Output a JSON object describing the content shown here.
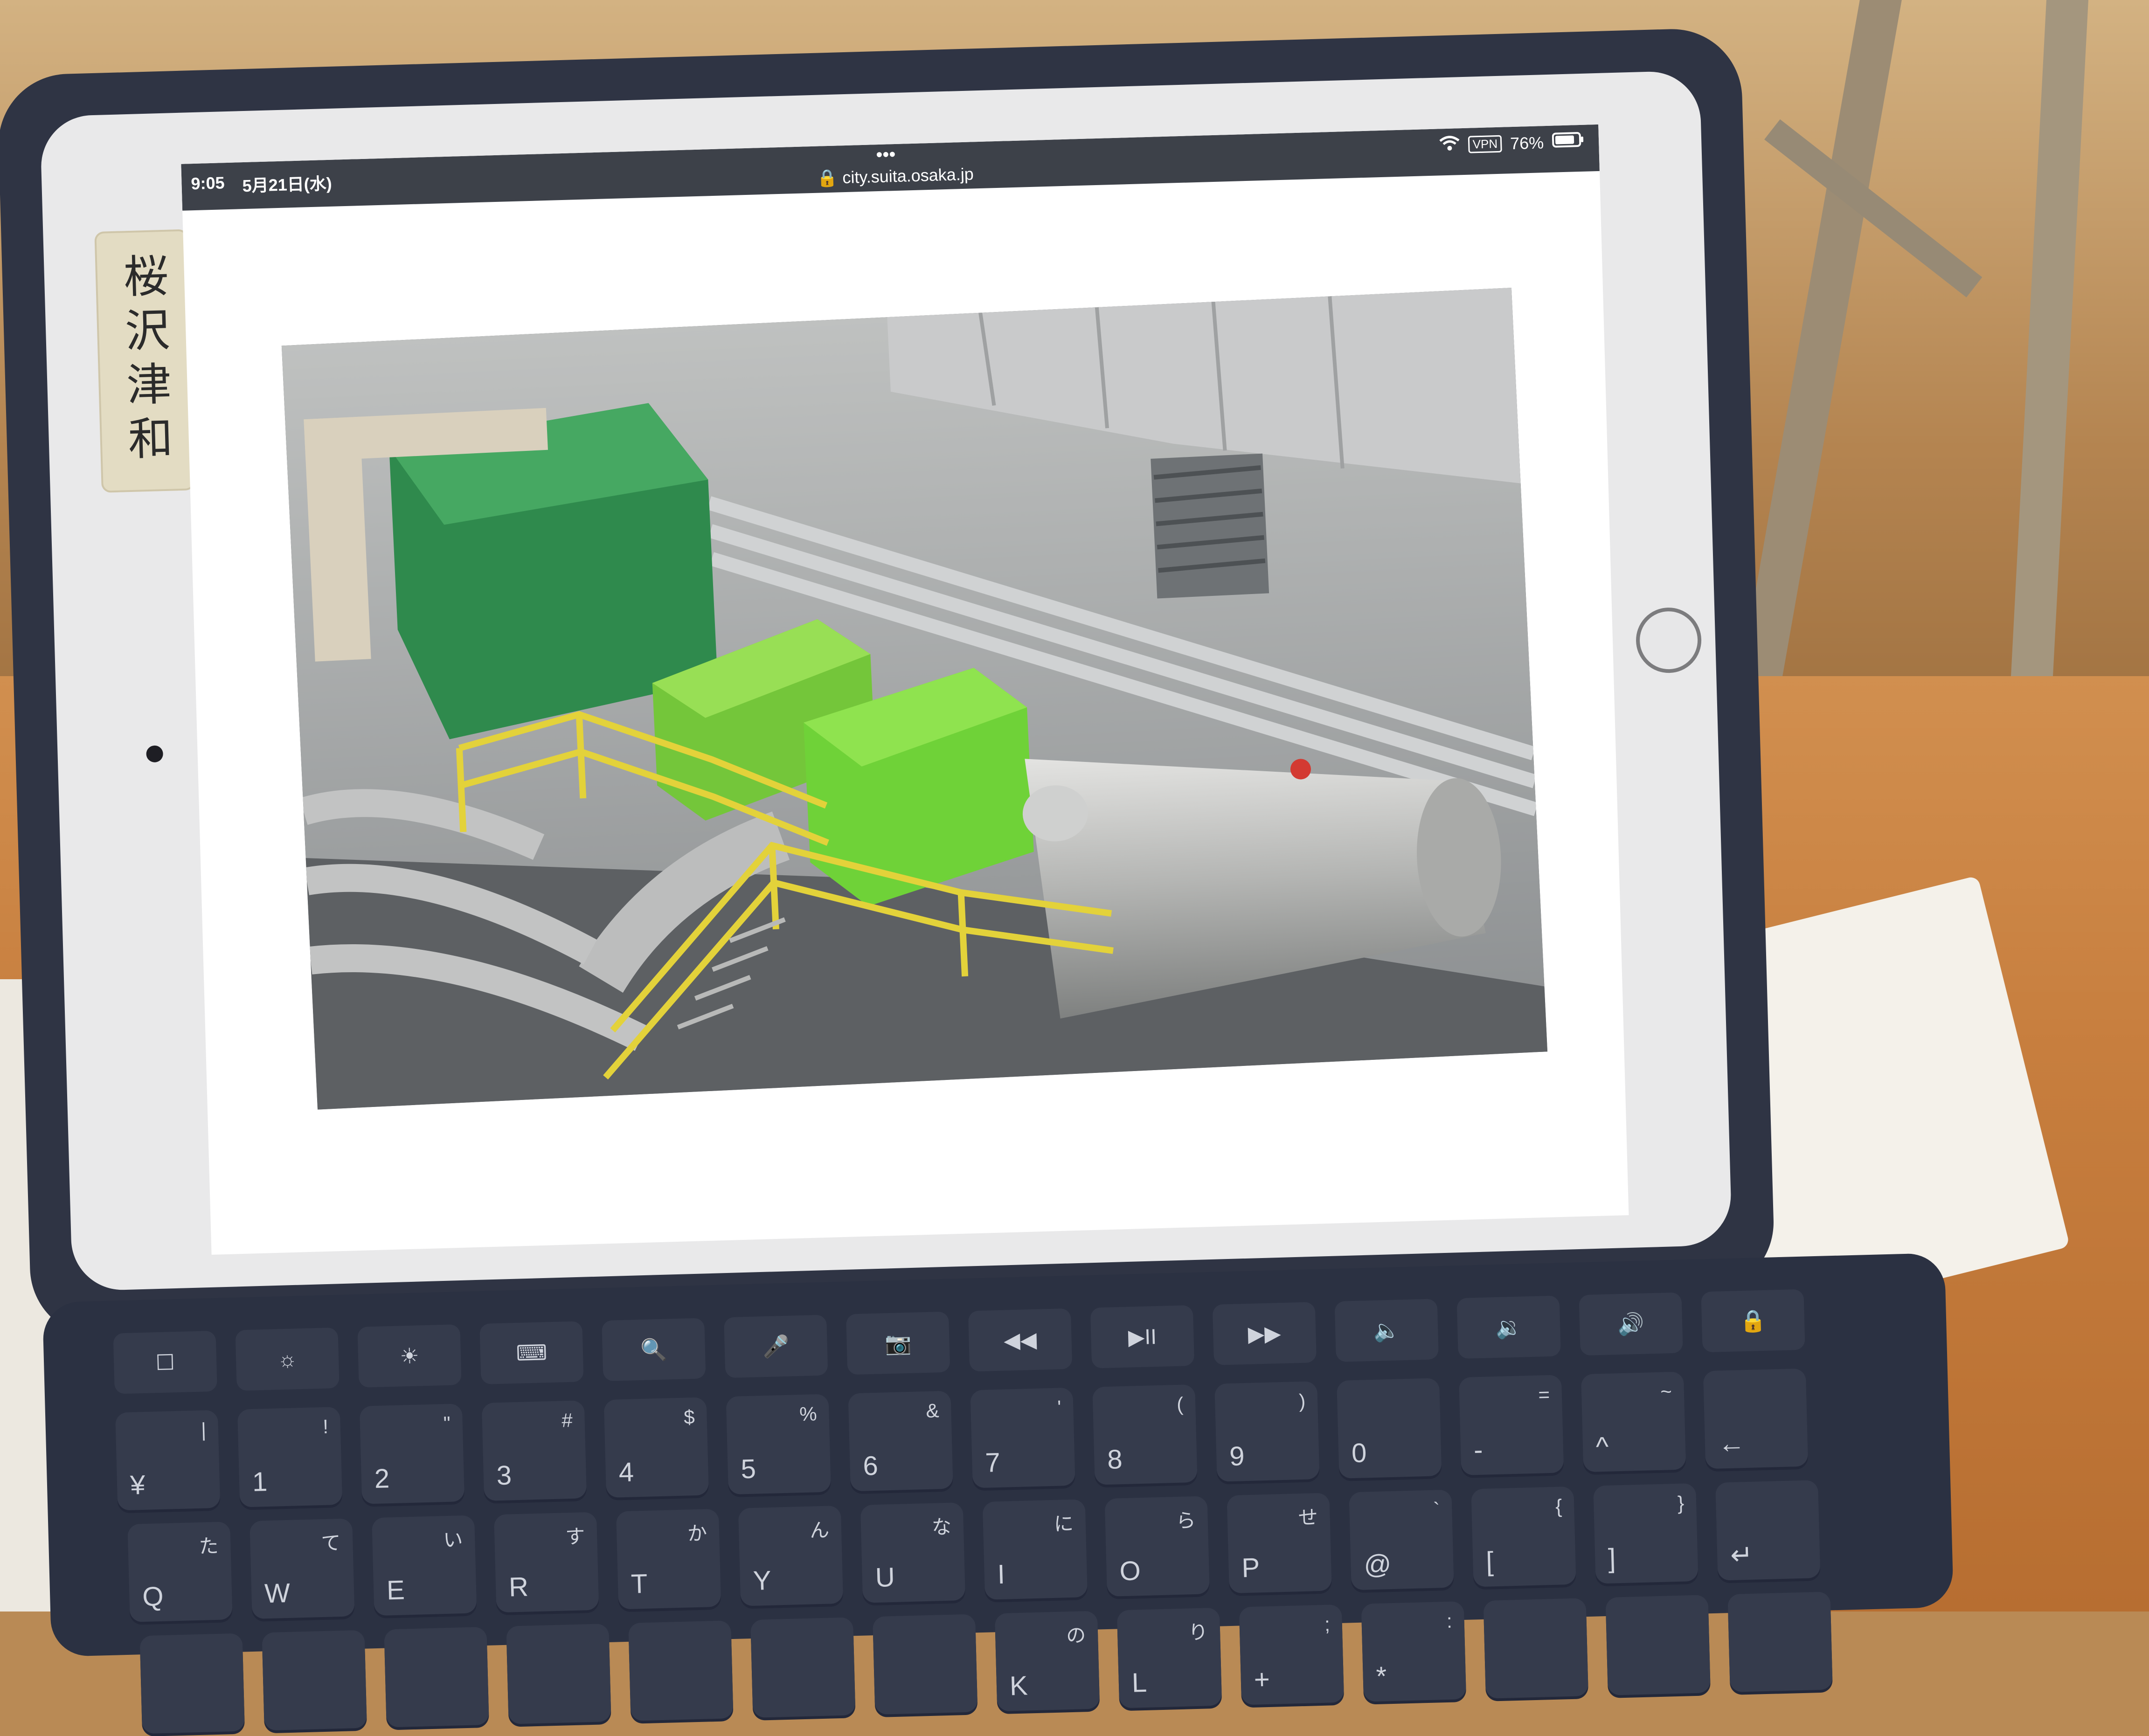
{
  "scene": {
    "sticker_label": "桜沢津和",
    "colors": {
      "device_frame": "#2f3444",
      "bezel": "#e9e9ea",
      "desk": "#c77e3e",
      "keyboard": "#2b3142"
    }
  },
  "status_bar": {
    "time": "9:05",
    "date": "5月21日(水)",
    "url": "city.suita.osaka.jp",
    "dots": "•••",
    "vpn": "VPN",
    "battery": "76%",
    "icons": [
      "wifi-icon",
      "lock-icon",
      "battery-icon"
    ]
  },
  "keyboard": {
    "function_row": [
      "☐",
      "☼",
      "☀",
      "⌨",
      "🔍",
      "🎤",
      "📷",
      "◀◀",
      "▶II",
      "▶▶",
      "🔈",
      "🔉",
      "🔊",
      "🔒"
    ],
    "number_row": [
      {
        "p": "¥",
        "s": "|"
      },
      {
        "p": "1",
        "s": "!"
      },
      {
        "p": "2",
        "s": "\""
      },
      {
        "p": "3",
        "s": "#"
      },
      {
        "p": "4",
        "s": "$"
      },
      {
        "p": "5",
        "s": "%"
      },
      {
        "p": "6",
        "s": "&"
      },
      {
        "p": "7",
        "s": "'"
      },
      {
        "p": "8",
        "s": "("
      },
      {
        "p": "9",
        "s": ")"
      },
      {
        "p": "0",
        "s": ""
      },
      {
        "p": "-",
        "s": "="
      },
      {
        "p": "^",
        "s": "~"
      },
      {
        "p": "←",
        "s": ""
      }
    ],
    "qwerty_row": [
      {
        "p": "Q",
        "s": "た"
      },
      {
        "p": "W",
        "s": "て"
      },
      {
        "p": "E",
        "s": "い"
      },
      {
        "p": "R",
        "s": "す"
      },
      {
        "p": "T",
        "s": "か"
      },
      {
        "p": "Y",
        "s": "ん"
      },
      {
        "p": "U",
        "s": "な"
      },
      {
        "p": "I",
        "s": "に"
      },
      {
        "p": "O",
        "s": "ら"
      },
      {
        "p": "P",
        "s": "せ"
      },
      {
        "p": "@",
        "s": "`"
      },
      {
        "p": "[",
        "s": "{"
      },
      {
        "p": "]",
        "s": "}"
      },
      {
        "p": "↵",
        "s": ""
      }
    ],
    "bottom_row": [
      {
        "p": "",
        "s": ""
      },
      {
        "p": "",
        "s": ""
      },
      {
        "p": "",
        "s": ""
      },
      {
        "p": "",
        "s": ""
      },
      {
        "p": "",
        "s": ""
      },
      {
        "p": "",
        "s": ""
      },
      {
        "p": "",
        "s": ""
      },
      {
        "p": "K",
        "s": "の"
      },
      {
        "p": "L",
        "s": "り"
      },
      {
        "p": "+",
        "s": ";"
      },
      {
        "p": "*",
        "s": ":"
      },
      {
        "p": "",
        "s": ""
      },
      {
        "p": "",
        "s": ""
      },
      {
        "p": "",
        "s": ""
      }
    ]
  }
}
